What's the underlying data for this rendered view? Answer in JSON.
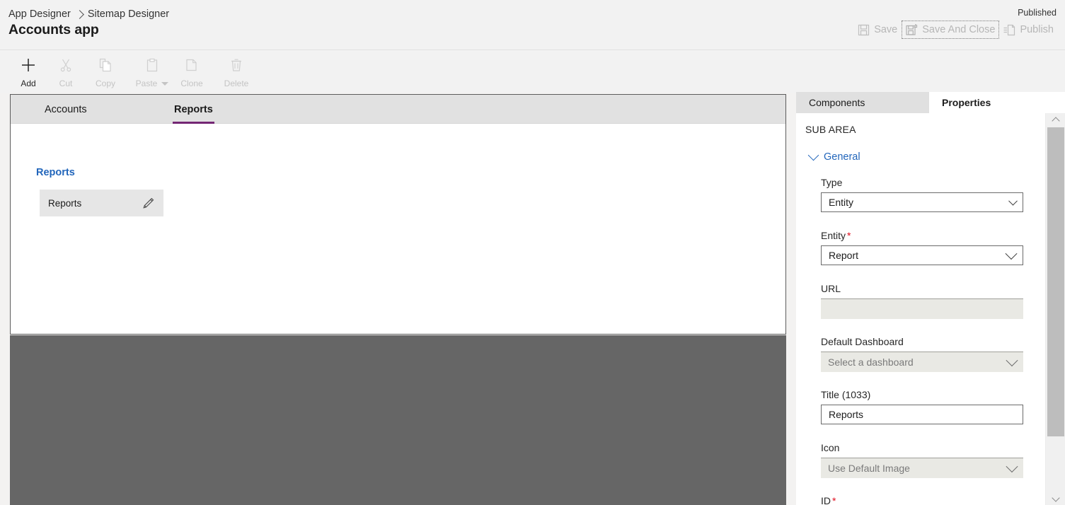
{
  "header": {
    "breadcrumb": [
      {
        "label": "App Designer"
      },
      {
        "label": "Sitemap Designer"
      }
    ],
    "app_title": "Accounts app",
    "status": "Published",
    "commands": [
      {
        "name": "save",
        "label": "Save",
        "icon": "save-icon",
        "enabled": false
      },
      {
        "name": "save-and-close",
        "label": "Save And Close",
        "icon": "save-and-close-icon",
        "enabled": false,
        "focused": true
      },
      {
        "name": "publish",
        "label": "Publish",
        "icon": "publish-icon",
        "enabled": false
      }
    ]
  },
  "toolbar": {
    "items": [
      {
        "name": "add",
        "label": "Add",
        "icon": "plus-icon",
        "enabled": true
      },
      {
        "name": "cut",
        "label": "Cut",
        "icon": "scissors-icon",
        "enabled": false
      },
      {
        "name": "copy",
        "label": "Copy",
        "icon": "copy-icon",
        "enabled": false
      },
      {
        "name": "paste",
        "label": "Paste",
        "icon": "clipboard-icon",
        "enabled": false,
        "has_menu": true
      },
      {
        "name": "clone",
        "label": "Clone",
        "icon": "clone-icon",
        "enabled": false
      },
      {
        "name": "delete",
        "label": "Delete",
        "icon": "trash-icon",
        "enabled": false
      }
    ]
  },
  "canvas": {
    "tabs": [
      {
        "label": "Accounts",
        "active": false
      },
      {
        "label": "Reports",
        "active": true
      }
    ],
    "accent_color": "#742774",
    "group": {
      "title": "Reports",
      "title_color": "#2266bb",
      "subareas": [
        {
          "label": "Reports",
          "edit_icon": "pencil-icon"
        }
      ]
    }
  },
  "properties_panel": {
    "tabs": [
      {
        "label": "Components",
        "active": false
      },
      {
        "label": "Properties",
        "active": true
      }
    ],
    "heading": "SUB AREA",
    "section": {
      "label": "General",
      "expanded": true,
      "color": "#2266bb"
    },
    "fields": [
      {
        "name": "type",
        "label": "Type",
        "control": "select",
        "value": "Entity",
        "required": false,
        "disabled": false
      },
      {
        "name": "entity",
        "label": "Entity",
        "control": "select",
        "value": "Report",
        "required": true,
        "required_mark": "*",
        "disabled": false,
        "focused": true
      },
      {
        "name": "url",
        "label": "URL",
        "control": "text",
        "value": "",
        "placeholder": "",
        "required": false,
        "disabled": true
      },
      {
        "name": "default-dashboard",
        "label": "Default Dashboard",
        "control": "select",
        "value": "",
        "placeholder": "Select a dashboard",
        "required": false,
        "disabled": true
      },
      {
        "name": "title-1033",
        "label": "Title (1033)",
        "control": "text",
        "value": "Reports",
        "placeholder": "",
        "required": false,
        "disabled": false
      },
      {
        "name": "icon",
        "label": "Icon",
        "control": "select",
        "value": "Use Default Image",
        "required": false,
        "disabled": true
      },
      {
        "name": "id",
        "label": "ID",
        "control": "text",
        "value": "",
        "required": true,
        "required_mark": "*",
        "disabled": false
      }
    ],
    "scrollbar": {
      "up_icon": "chevron-up-icon",
      "down_icon": "chevron-down-icon"
    }
  }
}
